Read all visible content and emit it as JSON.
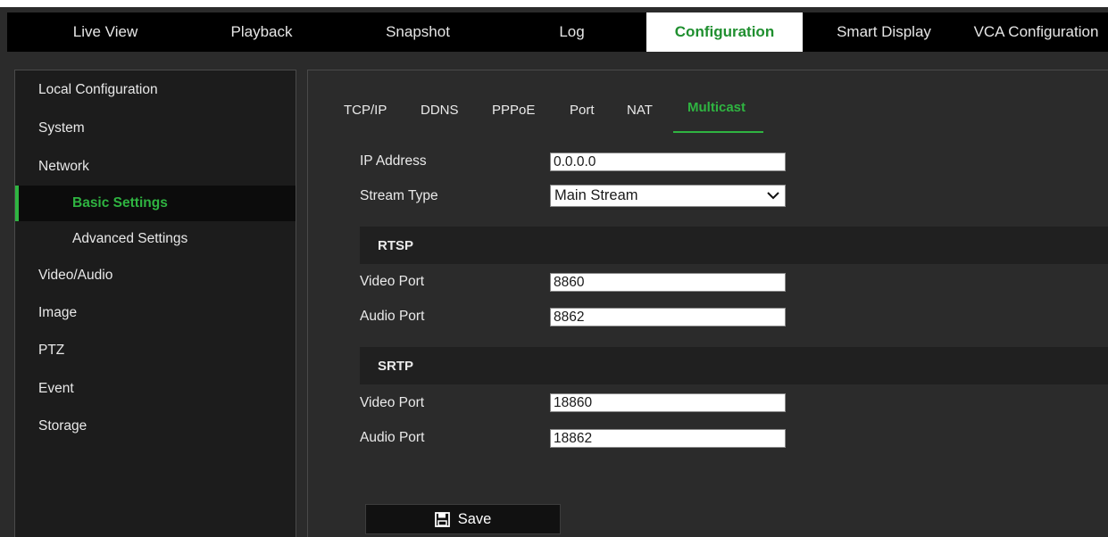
{
  "nav": {
    "items": [
      {
        "label": "Live View",
        "active": false
      },
      {
        "label": "Playback",
        "active": false
      },
      {
        "label": "Snapshot",
        "active": false
      },
      {
        "label": "Log",
        "active": false
      },
      {
        "label": "Configuration",
        "active": true
      },
      {
        "label": "Smart Display",
        "active": false
      },
      {
        "label": "VCA Configuration",
        "active": false
      }
    ]
  },
  "sidebar": {
    "items": [
      {
        "label": "Local Configuration",
        "level": 1,
        "active": false
      },
      {
        "label": "System",
        "level": 1,
        "active": false
      },
      {
        "label": "Network",
        "level": 1,
        "active": false
      },
      {
        "label": "Basic Settings",
        "level": 2,
        "active": true
      },
      {
        "label": "Advanced Settings",
        "level": 2,
        "active": false
      },
      {
        "label": "Video/Audio",
        "level": 1,
        "active": false
      },
      {
        "label": "Image",
        "level": 1,
        "active": false
      },
      {
        "label": "PTZ",
        "level": 1,
        "active": false
      },
      {
        "label": "Event",
        "level": 1,
        "active": false
      },
      {
        "label": "Storage",
        "level": 1,
        "active": false
      }
    ]
  },
  "tabs": [
    {
      "label": "TCP/IP",
      "active": false
    },
    {
      "label": "DDNS",
      "active": false
    },
    {
      "label": "PPPoE",
      "active": false
    },
    {
      "label": "Port",
      "active": false
    },
    {
      "label": "NAT",
      "active": false
    },
    {
      "label": "Multicast",
      "active": true
    }
  ],
  "form": {
    "ip_address": {
      "label": "IP Address",
      "value": "0.0.0.0"
    },
    "stream_type": {
      "label": "Stream Type",
      "value": "Main Stream"
    },
    "rtsp": {
      "title": "RTSP",
      "video_port": {
        "label": "Video Port",
        "value": "8860"
      },
      "audio_port": {
        "label": "Audio Port",
        "value": "8862"
      }
    },
    "srtp": {
      "title": "SRTP",
      "video_port": {
        "label": "Video Port",
        "value": "18860"
      },
      "audio_port": {
        "label": "Audio Port",
        "value": "18862"
      }
    }
  },
  "save": {
    "label": "Save",
    "icon": "floppy-disk-icon"
  },
  "colors": {
    "accent": "#2fb441",
    "nav_bg": "#000000",
    "panel_bg": "#2b2b2b"
  }
}
